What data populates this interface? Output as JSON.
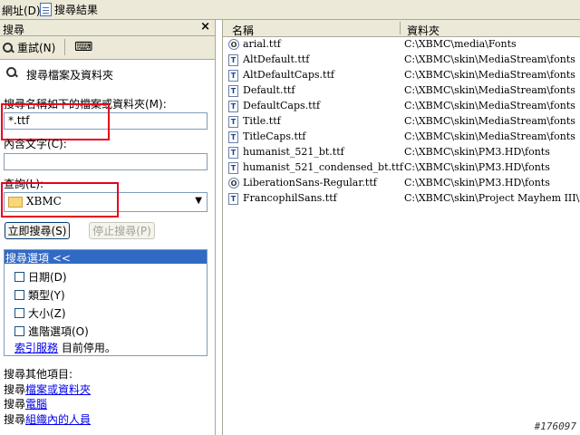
{
  "topbar": {
    "address_label": "網址(D)",
    "tab_label": "搜尋結果"
  },
  "left_pane": {
    "title": "搜尋",
    "close_glyph": "×",
    "reset_button": "重試(N)",
    "section_title": "搜尋檔案及資料夾",
    "name_label": "搜尋名稱如下的檔案或資料夾(M):",
    "name_value": "*.ttf",
    "contains_label": "內含文字(C):",
    "contains_value": "",
    "lookin_label": "查詢(L):",
    "lookin_value": "XBMC",
    "search_now_button": "立即搜尋(S)",
    "stop_search_button": "停止搜尋(P)",
    "options_title": "搜尋選項 <<",
    "options": [
      {
        "label": "日期(D)"
      },
      {
        "label": "類型(Y)"
      },
      {
        "label": "大小(Z)"
      },
      {
        "label": "進階選項(O)"
      }
    ],
    "index_service_link": "索引服務",
    "index_service_status": "目前停用。",
    "other_items_title": "搜尋其他項目:",
    "other_items": [
      {
        "prefix": "搜尋",
        "link": "檔案或資料夾"
      },
      {
        "prefix": "搜尋",
        "link": "電腦"
      },
      {
        "prefix": "搜尋",
        "link": "組織內的人員"
      }
    ]
  },
  "results": {
    "columns": {
      "name": "名稱",
      "folder": "資料夾"
    },
    "rows": [
      {
        "name": "arial.ttf",
        "folder": "C:\\XBMC\\media\\Fonts",
        "icon": "opentype-font-icon"
      },
      {
        "name": "AltDefault.ttf",
        "folder": "C:\\XBMC\\skin\\MediaStream\\fonts",
        "icon": "truetype-font-icon"
      },
      {
        "name": "AltDefaultCaps.ttf",
        "folder": "C:\\XBMC\\skin\\MediaStream\\fonts",
        "icon": "truetype-font-icon"
      },
      {
        "name": "Default.ttf",
        "folder": "C:\\XBMC\\skin\\MediaStream\\fonts",
        "icon": "truetype-font-icon"
      },
      {
        "name": "DefaultCaps.ttf",
        "folder": "C:\\XBMC\\skin\\MediaStream\\fonts",
        "icon": "truetype-font-icon"
      },
      {
        "name": "Title.ttf",
        "folder": "C:\\XBMC\\skin\\MediaStream\\fonts",
        "icon": "truetype-font-icon"
      },
      {
        "name": "TitleCaps.ttf",
        "folder": "C:\\XBMC\\skin\\MediaStream\\fonts",
        "icon": "truetype-font-icon"
      },
      {
        "name": "humanist_521_bt.ttf",
        "folder": "C:\\XBMC\\skin\\PM3.HD\\fonts",
        "icon": "truetype-font-icon"
      },
      {
        "name": "humanist_521_condensed_bt.ttf",
        "folder": "C:\\XBMC\\skin\\PM3.HD\\fonts",
        "icon": "truetype-font-icon"
      },
      {
        "name": "LiberationSans-Regular.ttf",
        "folder": "C:\\XBMC\\skin\\PM3.HD\\fonts",
        "icon": "opentype-font-icon"
      },
      {
        "name": "FrancophilSans.ttf",
        "folder": "C:\\XBMC\\skin\\Project Mayhem III\\fonts",
        "icon": "truetype-font-icon"
      }
    ]
  },
  "watermark": "#176097",
  "colors": {
    "highlight_box": "#e8001c",
    "options_header": "#316ac5",
    "chrome": "#ece9d8"
  }
}
